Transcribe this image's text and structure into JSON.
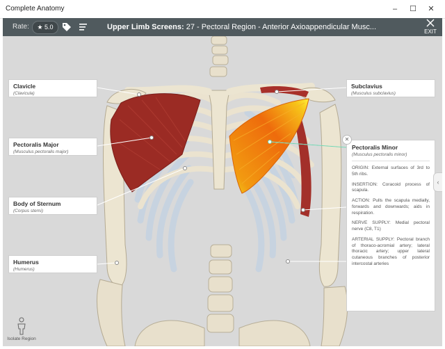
{
  "window": {
    "title": "Complete Anatomy",
    "minimize": "–",
    "maximize": "☐",
    "close": "✕"
  },
  "toolbar": {
    "rate_label": "Rate:",
    "rating": "★ 5.0",
    "title_bold": "Upper Limb Screens:",
    "title_rest": " 27 - Pectoral Region - Anterior Axioappendicular Musc...",
    "exit_label": "EXIT"
  },
  "labels": [
    {
      "name": "Clavicle",
      "latin": "(Clavicula)"
    },
    {
      "name": "Pectoralis Major",
      "latin": "(Musculus pectoralis major)"
    },
    {
      "name": "Body of Sternum",
      "latin": "(Corpus sterni)"
    },
    {
      "name": "Humerus",
      "latin": "(Humerus)"
    },
    {
      "name": "Subclavius",
      "latin": "(Musculus subclavius)"
    }
  ],
  "info": {
    "name": "Pectoralis Minor",
    "latin": "(Musculus pectoralis minor)",
    "origin": "ORIGIN: External surfaces of 3rd to 5th ribs.",
    "insertion": "INSERTION: Coracoid process of scapula.",
    "action": "ACTION: Pulls the scapula medially, forwards and downwards; aids in respiration.",
    "nerve": "NERVE SUPPLY: Medial pectoral nerve (C8, T1)",
    "arterial": "ARTERIAL SUPPLY: Pectoral branch of thoraco-acromial artery; lateral thoracic artery; upper lateral cutaneous branches of posterior intercostal arteries",
    "close": "✕"
  },
  "sidetab": "‹",
  "isolate_label": "Isolate Region",
  "colors": {
    "toolbar": "#505a5e",
    "muscle_red": "#9b2b24",
    "muscle_orange": "#f07a10",
    "bone": "#efe8d6",
    "cartilage": "#c9d6e3",
    "background": "#d9d9d9"
  }
}
